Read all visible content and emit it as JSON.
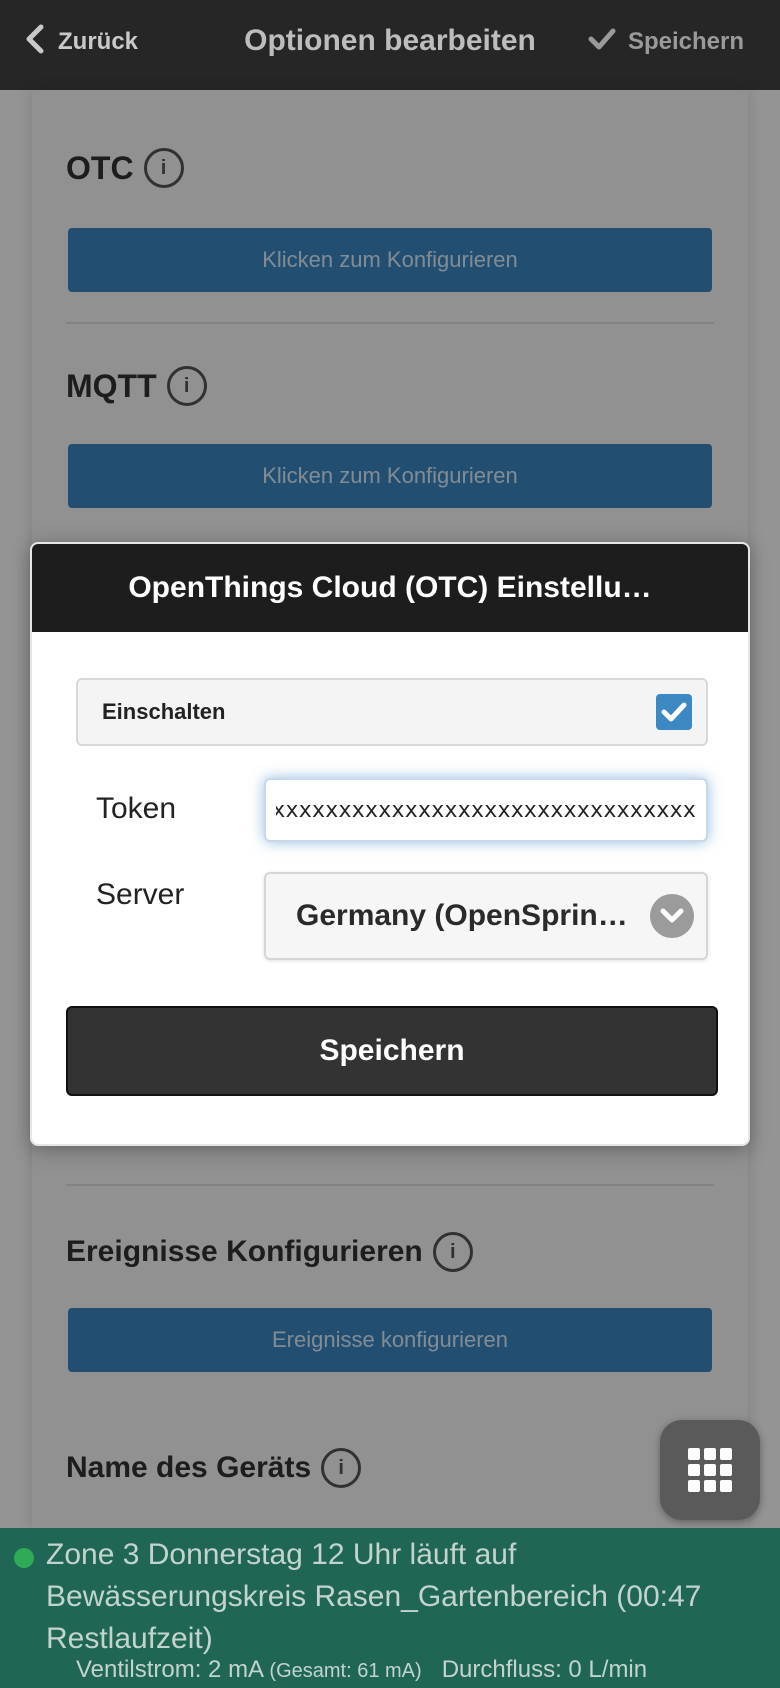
{
  "header": {
    "back_label": "Zurück",
    "title": "Optionen bearbeiten",
    "save_label": "Speichern"
  },
  "background": {
    "otc_label": "OTC",
    "otc_button": "Klicken zum Konfigurieren",
    "mqtt_label": "MQTT",
    "mqtt_button": "Klicken zum Konfigurieren",
    "events_label": "Ereignisse Konfigurieren",
    "events_button": "Ereignisse konfigurieren",
    "device_name_label": "Name des Geräts"
  },
  "dialog": {
    "title": "OpenThings Cloud (OTC) Einstellu…",
    "enable_label": "Einschalten",
    "enable_checked": true,
    "token_label": "Token",
    "token_value": "xxxxxxxxxxxxxxxxxxxxxxxxxxxxxxxxxxxxxxxxxx",
    "server_label": "Server",
    "server_value": "Germany (OpenSprin…",
    "save_button": "Speichern"
  },
  "status": {
    "message": "Zone 3 Donnerstag 12 Uhr läuft auf Bewässerungskreis Rasen_Gartenbereich (00:47 Restlaufzeit)",
    "valve_current": "Ventilstrom: 2 mA",
    "total_current": "(Gesamt: 61 mA)",
    "flow": "Durchfluss: 0 L/min",
    "dot_color": "#2faa58",
    "bar_color": "#1f6655"
  },
  "colors": {
    "accent": "#3b88c3",
    "header_bg": "#262626",
    "dialog_header_bg": "#1d1d1d"
  },
  "icons": {
    "back": "chevron-left-icon",
    "save": "checkmark-icon",
    "info": "info-icon",
    "select": "chevron-down-icon",
    "menu": "grid-icon"
  }
}
